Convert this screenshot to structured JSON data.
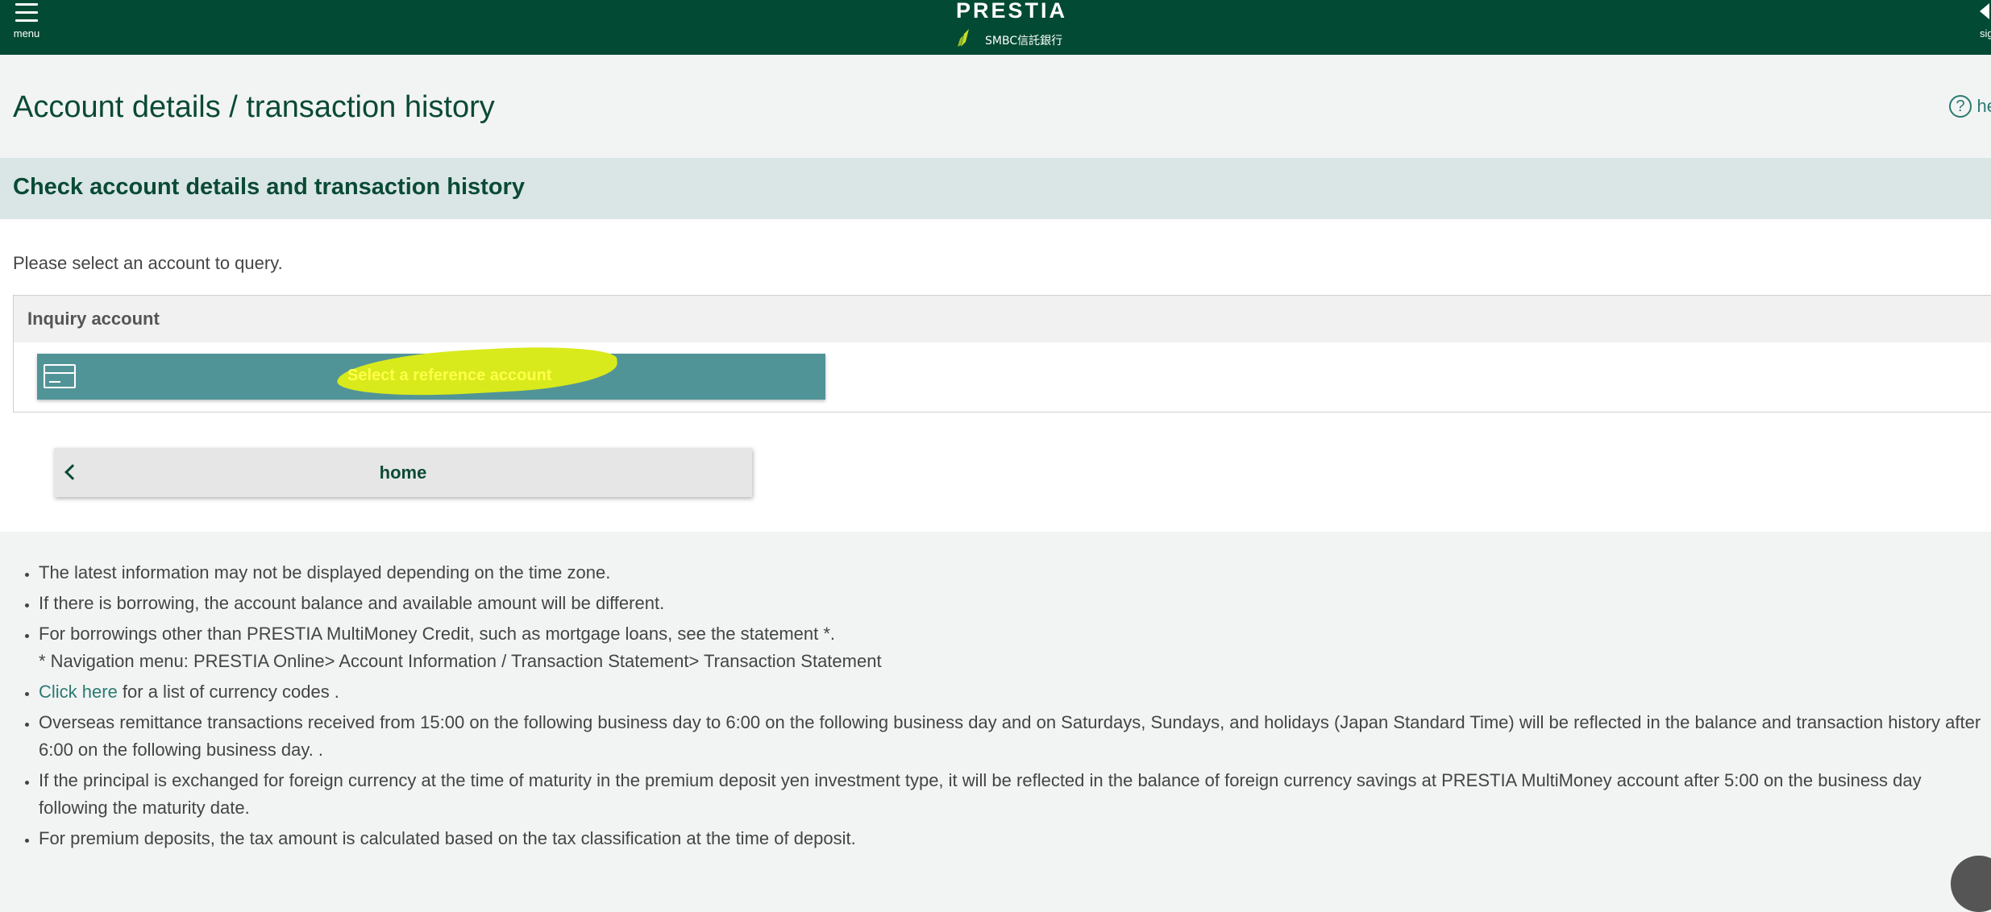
{
  "header": {
    "menu_label": "menu",
    "brand": "PRESTIA",
    "bank_name": "SMBC信託銀行",
    "signout_label": "sig"
  },
  "page": {
    "title": "Account details / transaction history",
    "help_label": "he"
  },
  "card": {
    "heading": "Check account details and transaction history",
    "instruction": "Please select an account to query.",
    "inquiry_label": "Inquiry account",
    "select_button": "Select a reference account",
    "home_button": "home"
  },
  "notes": {
    "n1": "The latest information may not be displayed depending on the time zone.",
    "n2": "If there is borrowing, the account balance and available amount will be different.",
    "n3": "For borrowings other than PRESTIA MultiMoney Credit, such as mortgage loans, see the statement *.",
    "n3_sub": "* Navigation menu: PRESTIA Online> Account Information / Transaction Statement> Transaction Statement",
    "n4_link": "Click here",
    "n4_text": " for a list of currency codes .",
    "n5": "Overseas remittance transactions received from 15:00 on the following business day to 6:00 on the following business day and on Saturdays, Sundays, and holidays (Japan Standard Time) will be reflected in the balance and transaction history after 6:00 on the following business day. .",
    "n6": "If the principal is exchanged for foreign currency at the time of maturity in the premium deposit yen investment type, it will be reflected in the balance of foreign currency savings at PRESTIA MultiMoney account after 5:00 on the business day following the maturity date.",
    "n7": "For premium deposits, the tax amount is calculated based on the tax classification at the time of deposit."
  },
  "colors": {
    "header_bg": "#024a33",
    "primary_text": "#0b4a35",
    "button_teal": "#519498",
    "link": "#2c7a74",
    "highlight": "#d8ea1b"
  }
}
